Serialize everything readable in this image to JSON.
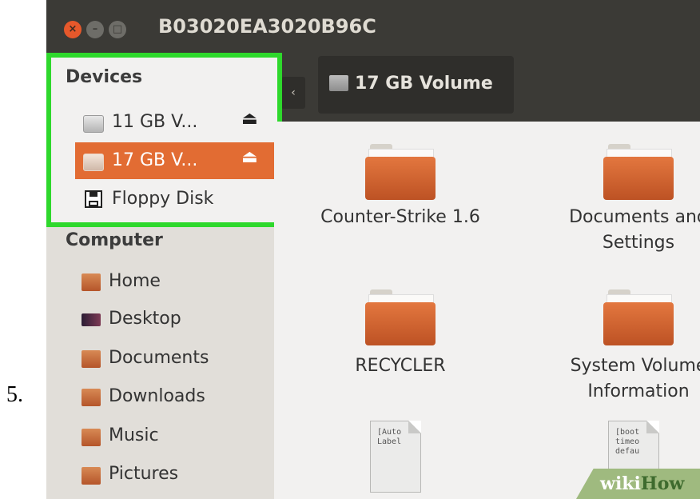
{
  "step_number": "5.",
  "window": {
    "title": "B03020EA3020B96C"
  },
  "toolbar": {
    "back_arrow": "‹",
    "path_button": "17 GB Volume"
  },
  "sidebar": {
    "devices_heading": "Devices",
    "devices": [
      {
        "label": "11 GB V...",
        "icon": "drive-icon",
        "eject": "⏏",
        "selected": false
      },
      {
        "label": "17 GB V...",
        "icon": "drive-icon",
        "eject": "⏏",
        "selected": true
      },
      {
        "label": "Floppy Disk",
        "icon": "floppy-icon",
        "selected": false
      }
    ],
    "computer_heading": "Computer",
    "places": [
      {
        "label": "Home",
        "icon": "home-folder-icon"
      },
      {
        "label": "Desktop",
        "icon": "desktop-icon"
      },
      {
        "label": "Documents",
        "icon": "documents-folder-icon"
      },
      {
        "label": "Downloads",
        "icon": "downloads-folder-icon"
      },
      {
        "label": "Music",
        "icon": "music-folder-icon"
      },
      {
        "label": "Pictures",
        "icon": "pictures-folder-icon"
      }
    ]
  },
  "content": {
    "items": [
      {
        "label": "Counter-Strike 1.6",
        "type": "folder"
      },
      {
        "label_line1": "Documents and",
        "label_line2": "Settings",
        "type": "folder"
      },
      {
        "label": "RECYCLER",
        "type": "folder"
      },
      {
        "label_line1": "System Volume",
        "label_line2": "Information",
        "type": "folder"
      },
      {
        "preview_lines": [
          "[Auto",
          "Label"
        ],
        "type": "text-file"
      },
      {
        "preview_lines": [
          "[boot",
          "timeo",
          "defau"
        ],
        "type": "text-file"
      }
    ]
  },
  "watermark": {
    "wiki": "wiki",
    "how": "How"
  },
  "colors": {
    "highlight": "#2ed82c",
    "selected": "#e26c33",
    "folder": "#d9692f",
    "titlebar": "#3b3a36"
  }
}
